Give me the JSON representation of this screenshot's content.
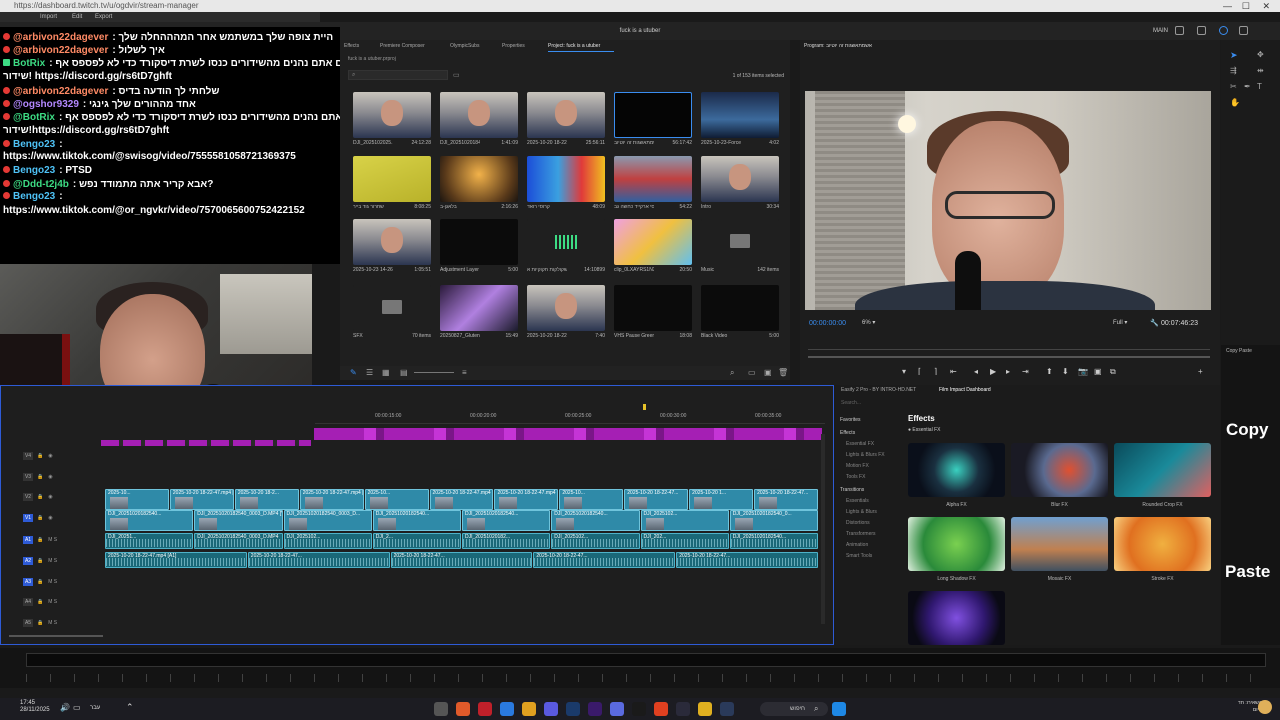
{
  "window": {
    "title": "fuck is a utuber",
    "workspace": "MAIN"
  },
  "menu": {
    "items": [
      "Import",
      "Edit",
      "Export"
    ],
    "effect_controls": "Effect Controls",
    "source": "Source: (no clips)",
    "no_clip": "(no clip selected)"
  },
  "chat": [
    {
      "user": "@arbivon22dagever",
      "msg": ": היית צופה שלך במשתמש אחר המהההחלה שלך",
      "color": "#ff8a65",
      "badge": "red"
    },
    {
      "user": "@arbivon22dagever",
      "msg": ": איך לשלול",
      "color": "#ff8a65",
      "badge": "red"
    },
    {
      "user": "BotRix",
      "msg": ": אם אתם נהנים מהשידורים כנסו לשרת דיסקורד כדי לא לפספס אף",
      "color": "#3ddc84",
      "badge": "green"
    },
    {
      "user": "",
      "msg": "שידור! https://discord.gg/rs6tD7ghft",
      "color": "#fff",
      "badge": ""
    },
    {
      "user": "@arbivon22dagever",
      "msg": ": שלחתי לך הודעה בדיס",
      "color": "#ff8a65",
      "badge": "red"
    },
    {
      "user": "@ogshor9329",
      "msg": ": אחד מההורים שלך גינגי",
      "color": "#b388ff",
      "badge": "red"
    },
    {
      "user": "@BotRix",
      "msg": ": אם אתם נהנים מהשידורים כנסו לשרת דיסקורד כדי לא לפספס אף",
      "color": "#3ddc84",
      "badge": "red"
    },
    {
      "user": "",
      "msg": "שידור!https://discord.gg/rs6tD7ghft",
      "color": "#fff",
      "badge": ""
    },
    {
      "user": "Bengo23",
      "msg": ":",
      "color": "#4fc3f7",
      "badge": "red"
    },
    {
      "user": "",
      "msg": "https://www.tiktok.com/@swisog/video/7555581058721369375",
      "color": "#fff",
      "badge": ""
    },
    {
      "user": "Bengo23",
      "msg": ": PTSD",
      "color": "#4fc3f7",
      "badge": "red"
    },
    {
      "user": "@Ddd-t2j4b",
      "msg": ": אבא קריר אתה מתמודד נפש?",
      "color": "#3ddc84",
      "badge": "red"
    },
    {
      "user": "Bengo23",
      "msg": ":",
      "color": "#4fc3f7",
      "badge": "red"
    },
    {
      "user": "",
      "msg": "https://www.tiktok.com/@or_ngvkr/video/7570065600752422152",
      "color": "#fff",
      "badge": ""
    }
  ],
  "project": {
    "tabs": [
      "Effects",
      "Premiere Composer",
      "OlympicSubs",
      "Properties",
      "Project: fuck is a utuber"
    ],
    "path": "fuck is a utuber.prproj",
    "items_count": "1 of 153 items selected",
    "items": [
      {
        "label": "DJI_2025102025...",
        "dur": "24:12:28",
        "kind": "person"
      },
      {
        "label": "DJI_202510201849...",
        "dur": "1:41:09",
        "kind": "person"
      },
      {
        "label": "2025-10-20 18-22-47...",
        "dur": "25:56:11",
        "kind": "person"
      },
      {
        "label": "אשמתאשגות זה יוטיוב...",
        "dur": "56:17:42",
        "kind": "selected"
      },
      {
        "label": "2025-10-23-Forcexe-I-K...",
        "dur": "4:02",
        "kind": "blue"
      },
      {
        "label": "שחרור גוד בייר",
        "dur": "8:08:25",
        "kind": "yellow"
      },
      {
        "label": "בלאגן-ב",
        "dur": "2:16:26",
        "kind": "orange"
      },
      {
        "label": "קרוסי רואד",
        "dur": "48:09",
        "kind": "arcade"
      },
      {
        "label": "קרוסי ארקייד כחשה גב",
        "dur": "54:22",
        "kind": "store"
      },
      {
        "label": "Intro",
        "dur": "30:34",
        "kind": "person"
      },
      {
        "label": "2025-10-23 14-26-34...",
        "dur": "1:05:51",
        "kind": "person"
      },
      {
        "label": "Adjustment Layer",
        "dur": "5:00",
        "kind": "black"
      },
      {
        "label": "משקולקות חקוקיות א...",
        "dur": "14:10899",
        "kind": "audio"
      },
      {
        "label": "clip_0LXAYRS1NXSM...",
        "dur": "20:50",
        "kind": "colorful"
      },
      {
        "label": "Music",
        "dur": "142 items",
        "kind": "folder"
      },
      {
        "label": "SFX",
        "dur": "70 items",
        "kind": "folder"
      },
      {
        "label": "20250827_GlutenFreeV...",
        "dur": "15:49",
        "kind": "purple"
      },
      {
        "label": "2025-10-20 18-22-47 פה נבן אין ליי...",
        "dur": "7:40",
        "kind": "person"
      },
      {
        "label": "VHS Pause Green Scre...",
        "dur": "18:08",
        "kind": "black"
      },
      {
        "label": "Black Video",
        "dur": "5:00",
        "kind": "black"
      }
    ]
  },
  "program": {
    "title": "Program: אשמתאשגות זה יוטיוב",
    "timecode": "00:00:00:00",
    "zoom": "6%",
    "quality": "Full",
    "duration": "00:07:46:23"
  },
  "right_panel": {
    "header": "Copy Paste",
    "copy": "Copy",
    "paste": "Paste"
  },
  "timeline": {
    "times": [
      "00:00:15:00",
      "00:00:20:00",
      "00:00:25:00",
      "00:00:30:00",
      "00:00:35:00"
    ],
    "tracks": [
      "V4",
      "V3",
      "V2",
      "V1",
      "A1",
      "A2",
      "A3",
      "A4",
      "A5"
    ],
    "v2_labels": [
      "2025-10...",
      "2025-10-20 18-22-47.mp4 [V]",
      "2025-10-20 18-2...",
      "2025-10-20 18-22-47.mp4 [V2]",
      "2025-10...",
      "2025-10-20 18-22-47.mp4 [V]",
      "2025-10-20 18-22-47.mp4 [V2]",
      "2025-10...",
      "2025-10-20 18-22-47...",
      "2025-10-20 1...",
      "2025-10-20 18-22-47..."
    ],
    "v1_labels": [
      "DJI_20251020182540...",
      "DJI_20251020182540_0003_D.MP4 [V1]",
      "DJI_20251020182540_0003_D...",
      "DJI_20251020182540...",
      "DJI_20251020182540...",
      "DJI_20251020182540...",
      "DJI_2025102...",
      "DJI_20251020182540_0..."
    ],
    "a1_labels": [
      "DJI_20251...",
      "DJI_20251020182540_0003_D.MP4",
      "DJI_2025102...",
      "DJI_2...",
      "DJI_20251020182...",
      "DJI_2025102...",
      "DJI_202...",
      "DJI_20251020182540..."
    ],
    "a2_labels": [
      "2025-10-20 18-22-47.mp4 [A1]",
      "2025-10-20 18-22-47...",
      "2025-10-20 18-22-47...",
      "2025-10-20 18-22-47...",
      "2025-10-20 18-22-47..."
    ]
  },
  "effects_panel": {
    "tabs": [
      "Easify 2 Pro - BY INTRO-HD.NET",
      "Film Impact Dashboard"
    ],
    "search": "Search...",
    "categories": [
      {
        "name": "Favorites",
        "group": true
      },
      {
        "name": "Effects",
        "group": true
      },
      {
        "name": "Essential FX",
        "group": false
      },
      {
        "name": "Lights & Blurs FX",
        "group": false
      },
      {
        "name": "Motion FX",
        "group": false
      },
      {
        "name": "Tools FX",
        "group": false
      },
      {
        "name": "Transitions",
        "group": true
      },
      {
        "name": "Essentials",
        "group": false
      },
      {
        "name": "Lights & Blurs",
        "group": false
      },
      {
        "name": "Distortions",
        "group": false
      },
      {
        "name": "Transformers",
        "group": false
      },
      {
        "name": "Animation",
        "group": false
      },
      {
        "name": "Smart Tools",
        "group": false
      }
    ],
    "title": "Effects",
    "subtitle": "● Essential FX",
    "fx": [
      "Alpha FX",
      "Blur FX",
      "Rounded Crop FX",
      "Long Shadow FX",
      "Mosaic FX",
      "Stroke FX",
      ""
    ]
  },
  "taskbar": {
    "time": "17:45",
    "date": "28/11/2025",
    "lang": "עבר",
    "search": "חיפוש",
    "weather_line1": "השאירו: חד",
    "weather_line2": "היום"
  }
}
